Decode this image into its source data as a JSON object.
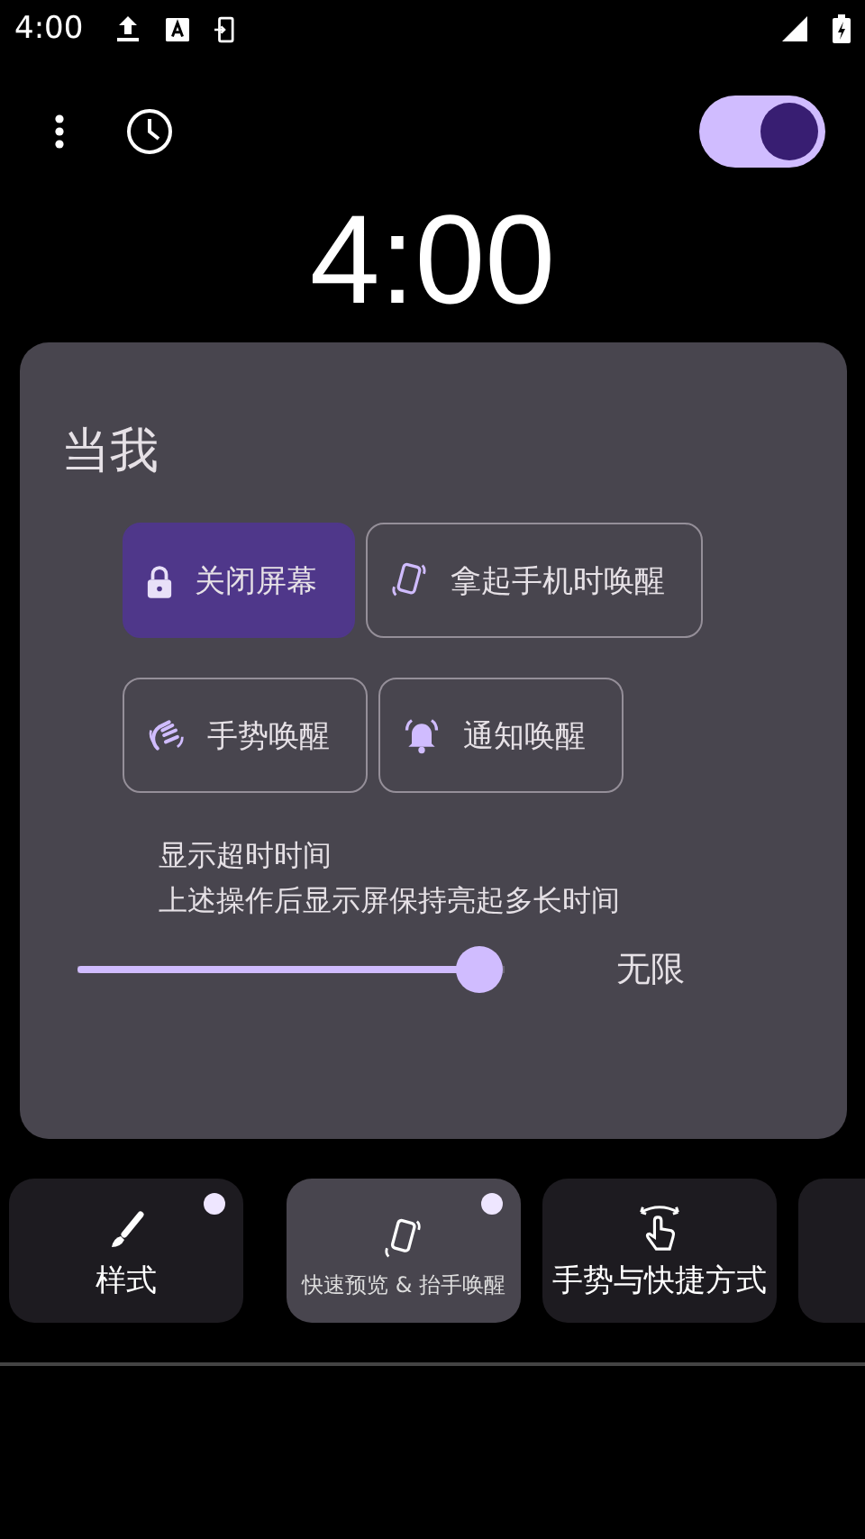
{
  "status_bar": {
    "time": "4:00"
  },
  "toolbar": {
    "switch_on": true
  },
  "clock": "4:00",
  "panel": {
    "title": "当我",
    "options": [
      {
        "label": "关闭屏幕",
        "kind": "lock",
        "selected": true
      },
      {
        "label": "拿起手机时唤醒",
        "kind": "lift",
        "selected": false
      },
      {
        "label": "手势唤醒",
        "kind": "wave",
        "selected": false
      },
      {
        "label": "通知唤醒",
        "kind": "bell",
        "selected": false
      }
    ],
    "timeout_title": "显示超时时间",
    "timeout_desc": "上述操作后显示屏保持亮起多长时间",
    "slider": {
      "level": 0.94,
      "reading": "无限"
    }
  },
  "tabs": [
    {
      "label": "样式",
      "kind": "brush",
      "selected": false,
      "dot": true
    },
    {
      "label": "快速预览 & 抬手唤醒",
      "kind": "lift",
      "selected": true,
      "dot": true
    },
    {
      "label": "手势与快捷方式",
      "kind": "gesture",
      "selected": false,
      "dot": false
    }
  ]
}
